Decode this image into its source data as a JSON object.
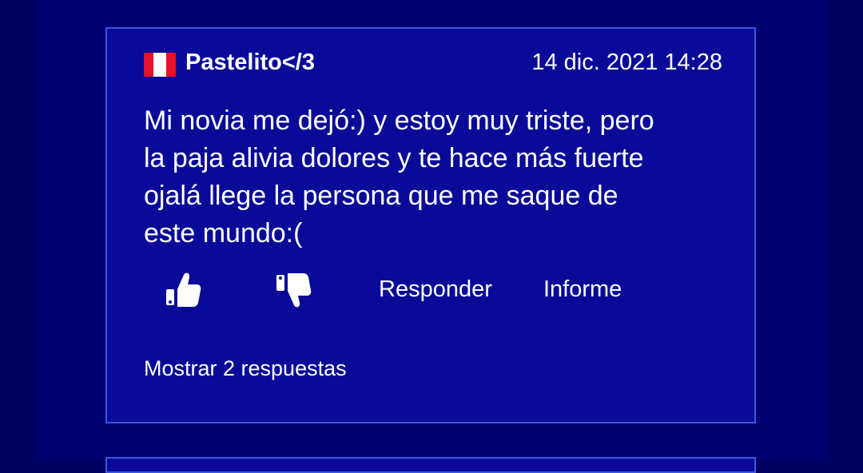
{
  "comment": {
    "author": "Pastelito</3",
    "country_flag": "peru-flag-icon",
    "timestamp": "14 dic. 2021 14:28",
    "text_lines": [
      "Mi novia me dejó:) y estoy muy triste, pero",
      "la paja alivia dolores y te hace más fuerte",
      "ojalá llege la persona que me saque de",
      "este mundo:("
    ],
    "actions": {
      "like_icon": "thumbs-up-icon",
      "dislike_icon": "thumbs-down-icon",
      "reply_label": "Responder",
      "report_label": "Informe"
    },
    "show_replies_label": "Mostrar 2 respuestas"
  },
  "colors": {
    "page_background": "#010060",
    "card_background": "#0a0a98",
    "card_border": "#3a55e0",
    "text": "#ffffff",
    "flag_red": "#e8102a"
  }
}
